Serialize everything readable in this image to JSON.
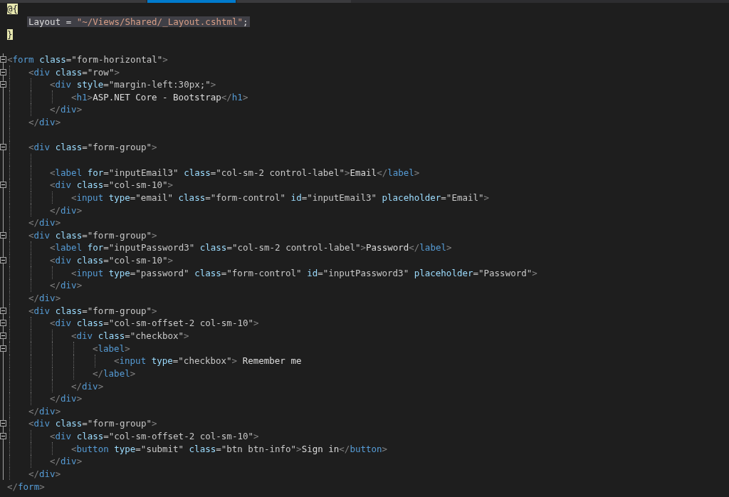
{
  "tabs": [
    {
      "selected": false
    },
    {
      "selected": true
    },
    {
      "selected": false
    }
  ],
  "lines": [
    {
      "kind": "code",
      "fold": false,
      "tokens": [
        {
          "kind": "razor",
          "text": "@{"
        }
      ],
      "children": [
        {
          "kind": "code",
          "highlighted": true,
          "tokens": [
            {
              "kind": "plain",
              "text": "Layout = "
            },
            {
              "kind": "string",
              "text": "\"~/Views/Shared/_Layout.cshtml\""
            },
            {
              "kind": "plain",
              "text": ";"
            }
          ]
        }
      ]
    },
    {
      "kind": "code",
      "tokens": [
        {
          "kind": "razor",
          "text": "}"
        }
      ]
    },
    {
      "kind": "blank"
    },
    {
      "kind": "code",
      "fold": true,
      "tokens": [
        {
          "kind": "punct",
          "text": "<"
        },
        {
          "kind": "tag",
          "text": "form"
        },
        {
          "kind": "attr",
          "text": " class"
        },
        {
          "kind": "value",
          "text": "=\"form-horizontal\""
        },
        {
          "kind": "punct",
          "text": ">"
        }
      ],
      "children": [
        {
          "kind": "code",
          "fold": true,
          "tokens": [
            {
              "kind": "punct",
              "text": "<"
            },
            {
              "kind": "tag",
              "text": "div"
            },
            {
              "kind": "attr",
              "text": " class"
            },
            {
              "kind": "value",
              "text": "=\"row\""
            },
            {
              "kind": "punct",
              "text": ">"
            }
          ],
          "children": [
            {
              "kind": "code",
              "fold": true,
              "tokens": [
                {
                  "kind": "punct",
                  "text": "<"
                },
                {
                  "kind": "tag",
                  "text": "div"
                },
                {
                  "kind": "attr",
                  "text": " style"
                },
                {
                  "kind": "value",
                  "text": "=\"margin-left:30px;\""
                },
                {
                  "kind": "punct",
                  "text": ">"
                }
              ],
              "children": [
                {
                  "kind": "code",
                  "tokens": [
                    {
                      "kind": "punct",
                      "text": "<"
                    },
                    {
                      "kind": "tag",
                      "text": "h1"
                    },
                    {
                      "kind": "punct",
                      "text": ">"
                    },
                    {
                      "kind": "plain",
                      "text": "ASP.NET Core - Bootstrap"
                    },
                    {
                      "kind": "punct",
                      "text": "</"
                    },
                    {
                      "kind": "tag",
                      "text": "h1"
                    },
                    {
                      "kind": "punct",
                      "text": ">"
                    }
                  ]
                }
              ]
            },
            {
              "kind": "code",
              "tokens": [
                {
                  "kind": "punct",
                  "text": "</"
                },
                {
                  "kind": "tag",
                  "text": "div"
                },
                {
                  "kind": "punct",
                  "text": ">"
                }
              ]
            }
          ]
        },
        {
          "kind": "code",
          "tokens": [
            {
              "kind": "punct",
              "text": "</"
            },
            {
              "kind": "tag",
              "text": "div"
            },
            {
              "kind": "punct",
              "text": ">"
            }
          ]
        },
        {
          "kind": "blank"
        },
        {
          "kind": "code",
          "fold": true,
          "tokens": [
            {
              "kind": "punct",
              "text": "<"
            },
            {
              "kind": "tag",
              "text": "div"
            },
            {
              "kind": "attr",
              "text": " class"
            },
            {
              "kind": "value",
              "text": "=\"form-group\""
            },
            {
              "kind": "punct",
              "text": ">"
            }
          ],
          "children": [
            {
              "kind": "blank"
            },
            {
              "kind": "code",
              "tokens": [
                {
                  "kind": "punct",
                  "text": "<"
                },
                {
                  "kind": "tag",
                  "text": "label"
                },
                {
                  "kind": "attr",
                  "text": " for"
                },
                {
                  "kind": "value",
                  "text": "=\"inputEmail3\""
                },
                {
                  "kind": "attr",
                  "text": " class"
                },
                {
                  "kind": "value",
                  "text": "=\"col-sm-2 control-label\""
                },
                {
                  "kind": "punct",
                  "text": ">"
                },
                {
                  "kind": "plain",
                  "text": "Email"
                },
                {
                  "kind": "punct",
                  "text": "</"
                },
                {
                  "kind": "tag",
                  "text": "label"
                },
                {
                  "kind": "punct",
                  "text": ">"
                }
              ]
            },
            {
              "kind": "code",
              "fold": true,
              "tokens": [
                {
                  "kind": "punct",
                  "text": "<"
                },
                {
                  "kind": "tag",
                  "text": "div"
                },
                {
                  "kind": "attr",
                  "text": " class"
                },
                {
                  "kind": "value",
                  "text": "=\"col-sm-10\""
                },
                {
                  "kind": "punct",
                  "text": ">"
                }
              ],
              "children": [
                {
                  "kind": "code",
                  "tokens": [
                    {
                      "kind": "punct",
                      "text": "<"
                    },
                    {
                      "kind": "tag",
                      "text": "input"
                    },
                    {
                      "kind": "attr",
                      "text": " type"
                    },
                    {
                      "kind": "value",
                      "text": "=\"email\""
                    },
                    {
                      "kind": "attr",
                      "text": " class"
                    },
                    {
                      "kind": "value",
                      "text": "=\"form-control\""
                    },
                    {
                      "kind": "attr",
                      "text": " id"
                    },
                    {
                      "kind": "value",
                      "text": "=\"inputEmail3\""
                    },
                    {
                      "kind": "attr",
                      "text": " placeholder"
                    },
                    {
                      "kind": "value",
                      "text": "=\"Email\""
                    },
                    {
                      "kind": "punct",
                      "text": ">"
                    }
                  ]
                }
              ]
            },
            {
              "kind": "code",
              "tokens": [
                {
                  "kind": "punct",
                  "text": "</"
                },
                {
                  "kind": "tag",
                  "text": "div"
                },
                {
                  "kind": "punct",
                  "text": ">"
                }
              ]
            }
          ]
        },
        {
          "kind": "code",
          "tokens": [
            {
              "kind": "punct",
              "text": "</"
            },
            {
              "kind": "tag",
              "text": "div"
            },
            {
              "kind": "punct",
              "text": ">"
            }
          ]
        },
        {
          "kind": "code",
          "fold": true,
          "tokens": [
            {
              "kind": "punct",
              "text": "<"
            },
            {
              "kind": "tag",
              "text": "div"
            },
            {
              "kind": "attr",
              "text": " class"
            },
            {
              "kind": "value",
              "text": "=\"form-group\""
            },
            {
              "kind": "punct",
              "text": ">"
            }
          ],
          "children": [
            {
              "kind": "code",
              "tokens": [
                {
                  "kind": "punct",
                  "text": "<"
                },
                {
                  "kind": "tag",
                  "text": "label"
                },
                {
                  "kind": "attr",
                  "text": " for"
                },
                {
                  "kind": "value",
                  "text": "=\"inputPassword3\""
                },
                {
                  "kind": "attr",
                  "text": " class"
                },
                {
                  "kind": "value",
                  "text": "=\"col-sm-2 control-label\""
                },
                {
                  "kind": "punct",
                  "text": ">"
                },
                {
                  "kind": "plain",
                  "text": "Password"
                },
                {
                  "kind": "punct",
                  "text": "</"
                },
                {
                  "kind": "tag",
                  "text": "label"
                },
                {
                  "kind": "punct",
                  "text": ">"
                }
              ]
            },
            {
              "kind": "code",
              "fold": true,
              "tokens": [
                {
                  "kind": "punct",
                  "text": "<"
                },
                {
                  "kind": "tag",
                  "text": "div"
                },
                {
                  "kind": "attr",
                  "text": " class"
                },
                {
                  "kind": "value",
                  "text": "=\"col-sm-10\""
                },
                {
                  "kind": "punct",
                  "text": ">"
                }
              ],
              "children": [
                {
                  "kind": "code",
                  "tokens": [
                    {
                      "kind": "punct",
                      "text": "<"
                    },
                    {
                      "kind": "tag",
                      "text": "input"
                    },
                    {
                      "kind": "attr",
                      "text": " type"
                    },
                    {
                      "kind": "value",
                      "text": "=\"password\""
                    },
                    {
                      "kind": "attr",
                      "text": " class"
                    },
                    {
                      "kind": "value",
                      "text": "=\"form-control\""
                    },
                    {
                      "kind": "attr",
                      "text": " id"
                    },
                    {
                      "kind": "value",
                      "text": "=\"inputPassword3\""
                    },
                    {
                      "kind": "attr",
                      "text": " placeholder"
                    },
                    {
                      "kind": "value",
                      "text": "=\"Password\""
                    },
                    {
                      "kind": "punct",
                      "text": ">"
                    }
                  ]
                }
              ]
            },
            {
              "kind": "code",
              "tokens": [
                {
                  "kind": "punct",
                  "text": "</"
                },
                {
                  "kind": "tag",
                  "text": "div"
                },
                {
                  "kind": "punct",
                  "text": ">"
                }
              ]
            }
          ]
        },
        {
          "kind": "code",
          "tokens": [
            {
              "kind": "punct",
              "text": "</"
            },
            {
              "kind": "tag",
              "text": "div"
            },
            {
              "kind": "punct",
              "text": ">"
            }
          ]
        },
        {
          "kind": "code",
          "fold": true,
          "tokens": [
            {
              "kind": "punct",
              "text": "<"
            },
            {
              "kind": "tag",
              "text": "div"
            },
            {
              "kind": "attr",
              "text": " class"
            },
            {
              "kind": "value",
              "text": "=\"form-group\""
            },
            {
              "kind": "punct",
              "text": ">"
            }
          ],
          "children": [
            {
              "kind": "code",
              "fold": true,
              "tokens": [
                {
                  "kind": "punct",
                  "text": "<"
                },
                {
                  "kind": "tag",
                  "text": "div"
                },
                {
                  "kind": "attr",
                  "text": " class"
                },
                {
                  "kind": "value",
                  "text": "=\"col-sm-offset-2 col-sm-10\""
                },
                {
                  "kind": "punct",
                  "text": ">"
                }
              ],
              "children": [
                {
                  "kind": "code",
                  "fold": true,
                  "tokens": [
                    {
                      "kind": "punct",
                      "text": "<"
                    },
                    {
                      "kind": "tag",
                      "text": "div"
                    },
                    {
                      "kind": "attr",
                      "text": " class"
                    },
                    {
                      "kind": "value",
                      "text": "=\"checkbox\""
                    },
                    {
                      "kind": "punct",
                      "text": ">"
                    }
                  ],
                  "children": [
                    {
                      "kind": "code",
                      "fold": true,
                      "tokens": [
                        {
                          "kind": "punct",
                          "text": "<"
                        },
                        {
                          "kind": "tag",
                          "text": "label"
                        },
                        {
                          "kind": "punct",
                          "text": ">"
                        }
                      ],
                      "children": [
                        {
                          "kind": "code",
                          "tokens": [
                            {
                              "kind": "punct",
                              "text": "<"
                            },
                            {
                              "kind": "tag",
                              "text": "input"
                            },
                            {
                              "kind": "attr",
                              "text": " type"
                            },
                            {
                              "kind": "value",
                              "text": "=\"checkbox\""
                            },
                            {
                              "kind": "punct",
                              "text": ">"
                            },
                            {
                              "kind": "plain",
                              "text": " Remember me"
                            }
                          ]
                        }
                      ]
                    },
                    {
                      "kind": "code",
                      "tokens": [
                        {
                          "kind": "punct",
                          "text": "</"
                        },
                        {
                          "kind": "tag",
                          "text": "label"
                        },
                        {
                          "kind": "punct",
                          "text": ">"
                        }
                      ]
                    }
                  ]
                },
                {
                  "kind": "code",
                  "tokens": [
                    {
                      "kind": "punct",
                      "text": "</"
                    },
                    {
                      "kind": "tag",
                      "text": "div"
                    },
                    {
                      "kind": "punct",
                      "text": ">"
                    }
                  ]
                }
              ]
            },
            {
              "kind": "code",
              "tokens": [
                {
                  "kind": "punct",
                  "text": "</"
                },
                {
                  "kind": "tag",
                  "text": "div"
                },
                {
                  "kind": "punct",
                  "text": ">"
                }
              ]
            }
          ]
        },
        {
          "kind": "code",
          "tokens": [
            {
              "kind": "punct",
              "text": "</"
            },
            {
              "kind": "tag",
              "text": "div"
            },
            {
              "kind": "punct",
              "text": ">"
            }
          ]
        },
        {
          "kind": "code",
          "fold": true,
          "tokens": [
            {
              "kind": "punct",
              "text": "<"
            },
            {
              "kind": "tag",
              "text": "div"
            },
            {
              "kind": "attr",
              "text": " class"
            },
            {
              "kind": "value",
              "text": "=\"form-group\""
            },
            {
              "kind": "punct",
              "text": ">"
            }
          ],
          "children": [
            {
              "kind": "code",
              "fold": true,
              "tokens": [
                {
                  "kind": "punct",
                  "text": "<"
                },
                {
                  "kind": "tag",
                  "text": "div"
                },
                {
                  "kind": "attr",
                  "text": " class"
                },
                {
                  "kind": "value",
                  "text": "=\"col-sm-offset-2 col-sm-10\""
                },
                {
                  "kind": "punct",
                  "text": ">"
                }
              ],
              "children": [
                {
                  "kind": "code",
                  "tokens": [
                    {
                      "kind": "punct",
                      "text": "<"
                    },
                    {
                      "kind": "tag",
                      "text": "button"
                    },
                    {
                      "kind": "attr",
                      "text": " type"
                    },
                    {
                      "kind": "value",
                      "text": "=\"submit\""
                    },
                    {
                      "kind": "attr",
                      "text": " class"
                    },
                    {
                      "kind": "value",
                      "text": "=\"btn btn-info\""
                    },
                    {
                      "kind": "punct",
                      "text": ">"
                    },
                    {
                      "kind": "plain",
                      "text": "Sign in"
                    },
                    {
                      "kind": "punct",
                      "text": "</"
                    },
                    {
                      "kind": "tag",
                      "text": "button"
                    },
                    {
                      "kind": "punct",
                      "text": ">"
                    }
                  ]
                }
              ]
            },
            {
              "kind": "code",
              "tokens": [
                {
                  "kind": "punct",
                  "text": "</"
                },
                {
                  "kind": "tag",
                  "text": "div"
                },
                {
                  "kind": "punct",
                  "text": ">"
                }
              ]
            }
          ]
        },
        {
          "kind": "code",
          "tokens": [
            {
              "kind": "punct",
              "text": "</"
            },
            {
              "kind": "tag",
              "text": "div"
            },
            {
              "kind": "punct",
              "text": ">"
            }
          ]
        }
      ]
    },
    {
      "kind": "code",
      "tokens": [
        {
          "kind": "punct",
          "text": "</"
        },
        {
          "kind": "tag",
          "text": "form"
        },
        {
          "kind": "punct",
          "text": ">"
        }
      ]
    }
  ]
}
